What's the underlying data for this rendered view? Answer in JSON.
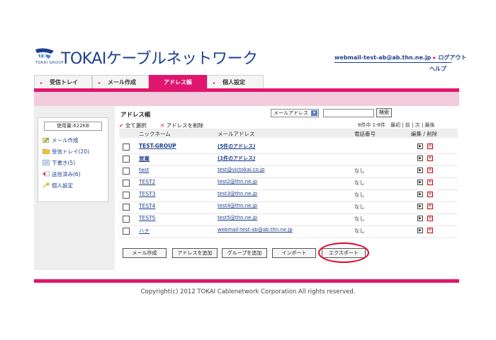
{
  "brand": {
    "mark": "TK",
    "sub": "TOKAI GROUP",
    "title": "TOKAIケーブルネットワーク"
  },
  "header": {
    "user_email": "webmail-test-ab@ab.thn.ne.jp",
    "separator": "▸",
    "logout": "ログアウト",
    "help": "ヘルプ"
  },
  "tabs": [
    {
      "label": "受信トレイ",
      "arrow": "▸"
    },
    {
      "label": "メール作成",
      "arrow": "▸"
    },
    {
      "label": "アドレス帳",
      "arrow": "▸"
    },
    {
      "label": "個人設定",
      "arrow": "▸"
    }
  ],
  "sidebar": {
    "usage": "使用量:622KB",
    "items": [
      {
        "label": "メール作成",
        "icon": "compose-icon"
      },
      {
        "label": "受信トレイ(20)",
        "icon": "inbox-folder-icon"
      },
      {
        "label": "下書き(5)",
        "icon": "drafts-icon"
      },
      {
        "label": "送信済み(6)",
        "icon": "sent-icon"
      },
      {
        "label": "個人設定",
        "icon": "settings-key-icon"
      }
    ]
  },
  "main": {
    "title": "アドレス帳",
    "search_select": "メールアドレス",
    "search_caret": "▾",
    "search_button": "検索",
    "select_all": "全て選択",
    "select_all_mark": "✔",
    "delete_addr": "アドレスを削除",
    "delete_mark": "✕",
    "pager": "8件中 1-8件　最初 | 前 | 次 | 最後",
    "columns": {
      "nickname": "ニックネーム",
      "mail": "メールアドレス",
      "phone": "電話番号",
      "edit": "編集 / 削除"
    },
    "edit_glyph": "▶",
    "delete_glyph": "✕",
    "rows": [
      {
        "nickname": "TEST-GROUP",
        "mail": "(5件のアドレス)",
        "phone": ""
      },
      {
        "nickname": "営業",
        "mail": "(1件のアドレス)",
        "phone": ""
      },
      {
        "nickname": "test",
        "mail": "test@victokai.co.jp",
        "phone": "なし"
      },
      {
        "nickname": "TEST2",
        "mail": "test2@thn.ne.jp",
        "phone": "なし"
      },
      {
        "nickname": "TEST3",
        "mail": "test3@thn.ne.jp",
        "phone": "なし"
      },
      {
        "nickname": "TEST4",
        "mail": "test4@thn.ne.jp",
        "phone": "なし"
      },
      {
        "nickname": "TEST5",
        "mail": "test5@thn.ne.jp",
        "phone": "なし"
      },
      {
        "nickname": "ハナ",
        "mail": "webmail-test-ab@ab.thn.ne.jp",
        "phone": "なし"
      }
    ],
    "buttons": {
      "compose": "メール作成",
      "add_address": "アドレスを追加",
      "add_group": "グループを追加",
      "import": "インポート",
      "export": "エクスポート"
    }
  },
  "footer": {
    "copyright": "Copyright(c) 2012 TOKAI Cablenetwork Corporation All rights reserved."
  },
  "colors": {
    "accent": "#e0166e",
    "link": "#1d3f8f",
    "highlight": "#e0002a"
  }
}
